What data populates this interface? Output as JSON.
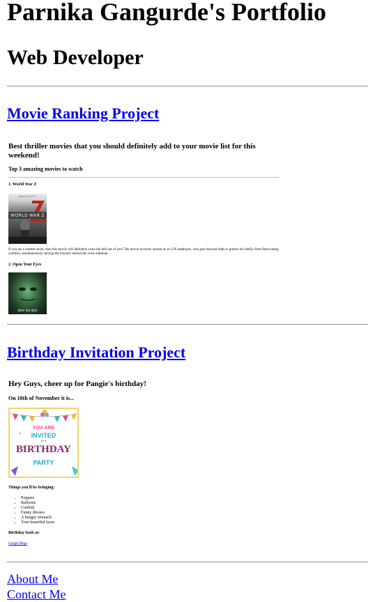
{
  "header": {
    "title": "Parnika Gangurde's Portfolio",
    "subtitle": "Web Developer"
  },
  "projects": [
    {
      "title": "Movie Ranking Project",
      "preview": {
        "heading": "Best thriller movies that you should definitely add to your movie list for this weekend!",
        "subheading": "Top 3 amazing movies to watch",
        "movies": [
          {
            "title": "1. World War Z",
            "poster_text": "WORLD WAR Z",
            "poster_cast": "BRAD PITT",
            "description": "If you are a zombie-lover, then this movie will definitely scare the hell out of you! The movie revolves around an ex-UN employee, who goes beyond odds to protect his family from flesh-eating zombies, simultaneously solving the mystery behind the virus outbreak."
          },
          {
            "title": "2. Open Your Eyes",
            "poster_text": "abre los ojos"
          }
        ]
      }
    },
    {
      "title": "Birthday Invitation Project",
      "preview": {
        "heading": "Hey Guys, cheer up for Pangie's birthday!",
        "date_line": "On 18th of November it is...",
        "card": {
          "line1": "YOU ARE",
          "line2": "INVITED",
          "line3": "to a",
          "line4": "BIRTHDAY",
          "line5": "PARTY"
        },
        "bring_heading": "Things you'll be bringing:",
        "items": [
          "Poppers",
          "Balloons",
          "Confetti",
          "Funny dresses",
          "A hungry stomach",
          "Your beautiful faces"
        ],
        "bash_heading": "Birthday bash at:",
        "map_link": "Google Maps"
      }
    }
  ],
  "footer": {
    "about_label": "About Me",
    "contact_label": "Contact Me"
  },
  "colors": {
    "link": "#0000ee",
    "rule": "#9a9a9a"
  }
}
